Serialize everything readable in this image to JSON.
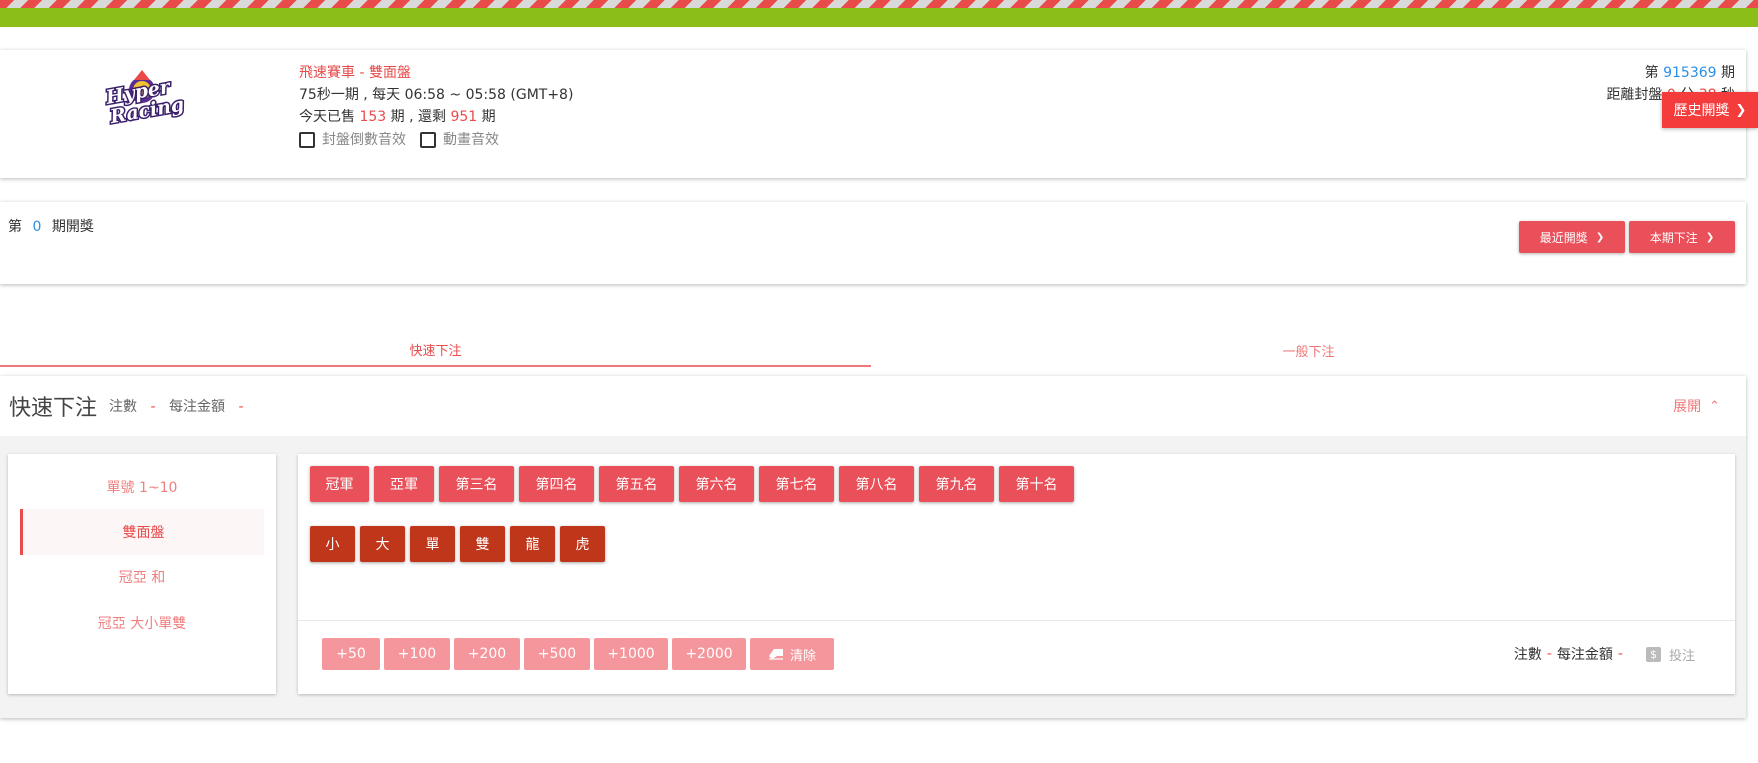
{
  "header": {
    "logo_text_line1": "Hyper",
    "logo_text_line2": "Racing",
    "game_title": "飛速賽車 - 雙面盤",
    "schedule": "75秒一期 , 每天 06:58 ~ 05:58 (GMT+8)",
    "sold_prefix": "今天已售",
    "sold_count": "153",
    "sold_mid": "期 , 還剩",
    "remaining_count": "951",
    "sold_suffix": "期",
    "option_countdown_sound": "封盤倒數音效",
    "option_animation_sound": "動畫音效",
    "period_prefix": "第",
    "period_number": "915369",
    "period_suffix": "期",
    "close_label": "距離封盤",
    "close_minutes": "0",
    "close_min_unit": "分",
    "close_seconds": "38",
    "close_sec_unit": "秒",
    "history_button": "歷史開獎"
  },
  "draw": {
    "prefix": "第",
    "period": "0",
    "suffix": "期開獎",
    "recent_draw_button": "最近開獎",
    "current_bets_button": "本期下注"
  },
  "tabs": {
    "quick": "快速下注",
    "normal": "一般下注"
  },
  "quick": {
    "title": "快速下注",
    "count_label": "注數",
    "count_value": "-",
    "amount_label": "每注金額",
    "amount_value": "-",
    "expand_label": "展開"
  },
  "side_menu": [
    {
      "label": "單號 1~10",
      "active": false
    },
    {
      "label": "雙面盤",
      "active": true
    },
    {
      "label": "冠亞 和",
      "active": false
    },
    {
      "label": "冠亞 大小單雙",
      "active": false
    }
  ],
  "positions": [
    "冠軍",
    "亞軍",
    "第三名",
    "第四名",
    "第五名",
    "第六名",
    "第七名",
    "第八名",
    "第九名",
    "第十名"
  ],
  "bet_types": [
    "小",
    "大",
    "單",
    "雙",
    "龍",
    "虎"
  ],
  "amounts": [
    "+50",
    "+100",
    "+200",
    "+500",
    "+1000",
    "+2000"
  ],
  "clear_label": "清除",
  "summary": {
    "count_label": "注數",
    "count_value": "-",
    "amount_label": "每注金額",
    "amount_value": "-",
    "bet_label": "投注"
  },
  "colors": {
    "accent": "#e94b4b",
    "button_red": "#e9505a",
    "button_dark": "#c0361b",
    "button_light": "#f4969b",
    "history_red": "#f43c3c",
    "stripe_green": "#8cbe1a",
    "link_blue": "#2b8fe6"
  }
}
